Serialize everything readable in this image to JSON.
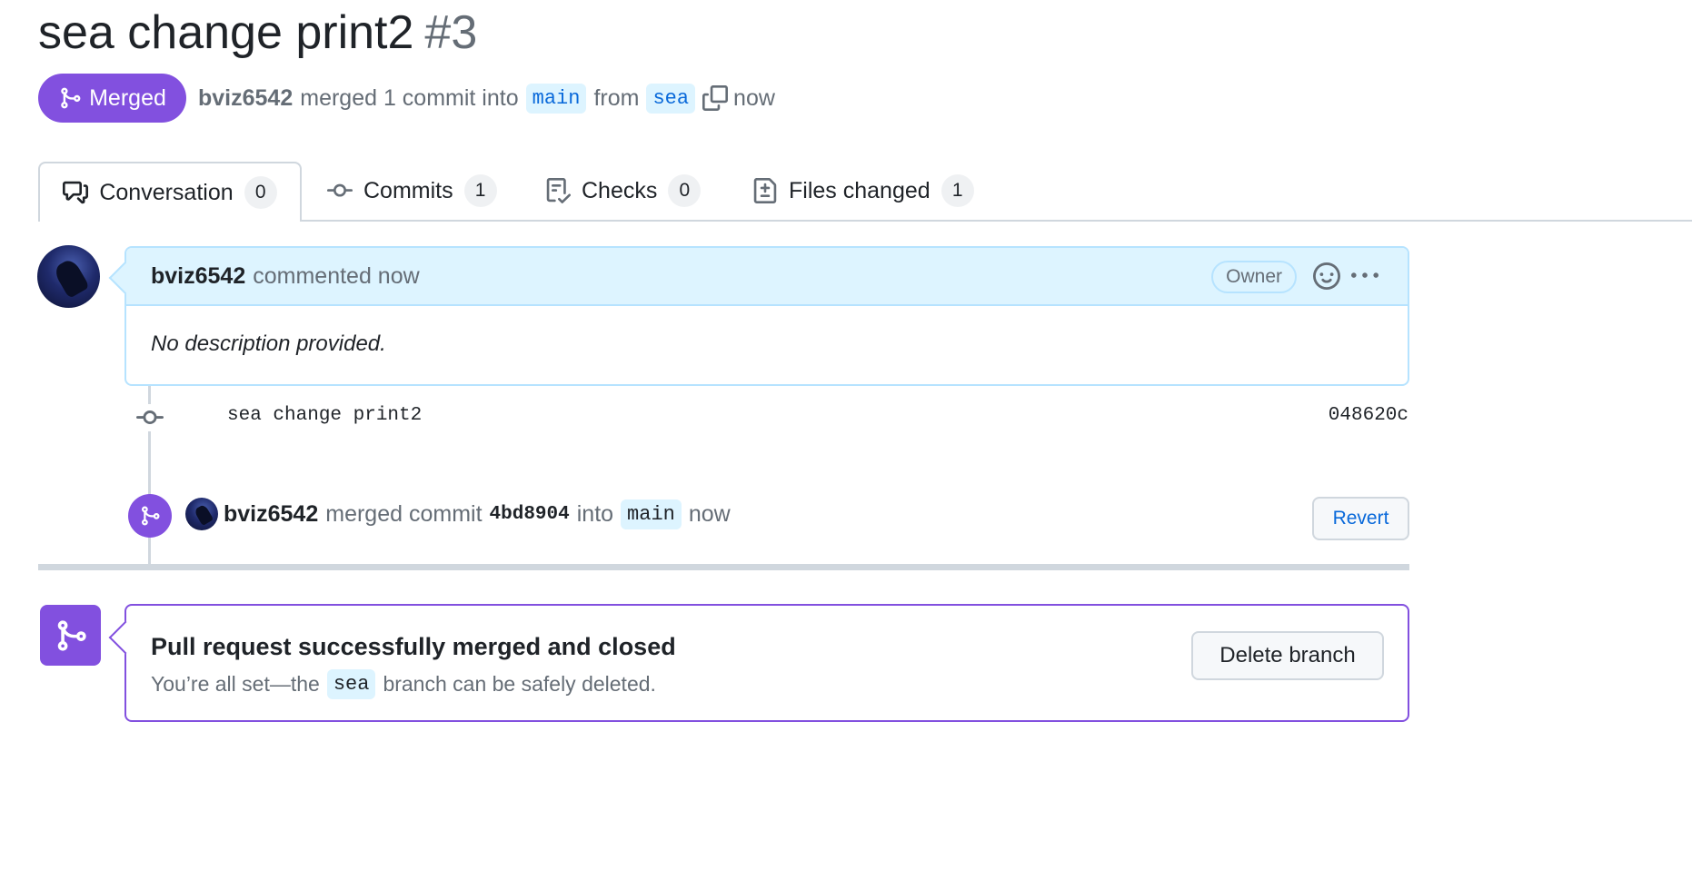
{
  "pr": {
    "title": "sea change print2",
    "number": "#3",
    "state": "Merged",
    "author": "bviz6542",
    "merged_text": "merged 1 commit into",
    "base_branch": "main",
    "from_text": "from",
    "head_branch": "sea",
    "time": "now"
  },
  "tabs": [
    {
      "label": "Conversation",
      "count": "0"
    },
    {
      "label": "Commits",
      "count": "1"
    },
    {
      "label": "Checks",
      "count": "0"
    },
    {
      "label": "Files changed",
      "count": "1"
    }
  ],
  "comment": {
    "author": "bviz6542",
    "action": "commented now",
    "role": "Owner",
    "body": "No description provided."
  },
  "commit": {
    "message": "sea change print2",
    "sha": "048620c"
  },
  "merge_event": {
    "author": "bviz6542",
    "text": "merged commit",
    "sha": "4bd8904",
    "into": "into",
    "branch": "main",
    "time": "now",
    "revert_label": "Revert"
  },
  "merged_box": {
    "title": "Pull request successfully merged and closed",
    "sub_before": "You’re all set—the",
    "branch": "sea",
    "sub_after": "branch can be safely deleted.",
    "delete_label": "Delete branch"
  },
  "colors": {
    "merged": "#8250df",
    "link": "#0969da",
    "branch_bg": "#ddf4ff"
  }
}
